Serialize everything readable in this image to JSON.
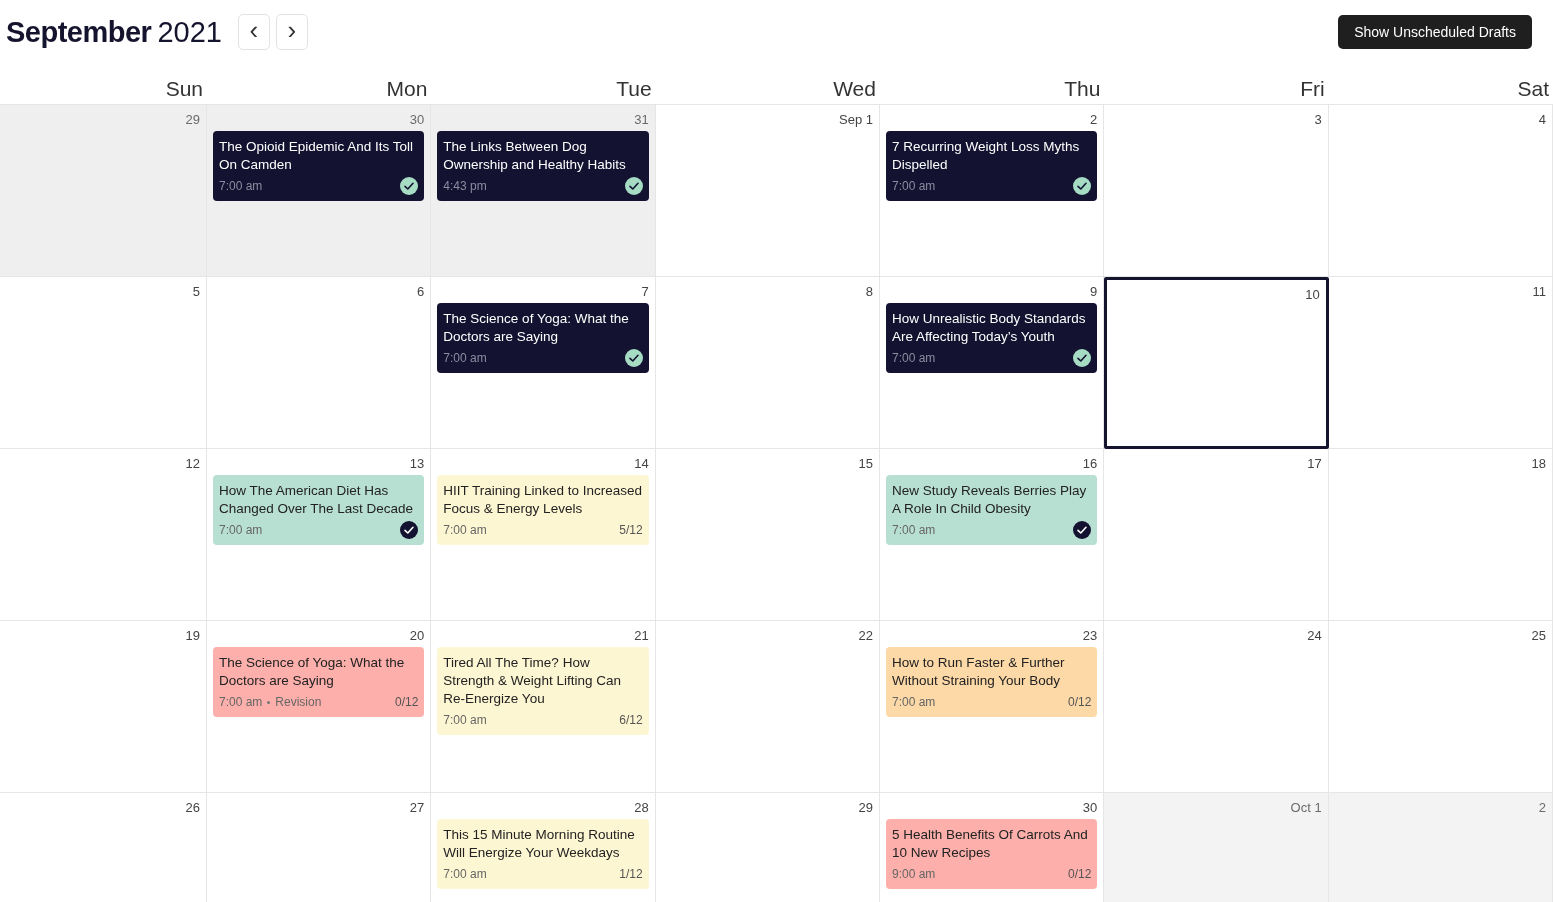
{
  "header": {
    "month": "September",
    "year": "2021",
    "prev_button": "‹",
    "next_button": "›",
    "drafts_button": "Show Unscheduled Drafts"
  },
  "weekdays": [
    "Sun",
    "Mon",
    "Tue",
    "Wed",
    "Thu",
    "Fri",
    "Sat"
  ],
  "weeks": [
    [
      {
        "label": "29",
        "outside": true,
        "today": false
      },
      {
        "label": "30",
        "outside": true,
        "today": false,
        "posts": [
          {
            "kind": "published",
            "color": "#131230",
            "title": "The Opioid Epidemic And Its Toll On Camden",
            "time": "7:00 am"
          }
        ]
      },
      {
        "label": "31",
        "outside": true,
        "today": false,
        "posts": [
          {
            "kind": "published",
            "color": "#131230",
            "title": "The Links Between Dog Ownership and Healthy Habits",
            "time": "4:43 pm"
          }
        ]
      },
      {
        "label": "Sep 1",
        "outside": false,
        "today": false
      },
      {
        "label": "2",
        "outside": false,
        "today": false,
        "posts": [
          {
            "kind": "published",
            "color": "#131230",
            "title": "7 Recurring Weight Loss Myths Dispelled",
            "time": "7:00 am"
          }
        ]
      },
      {
        "label": "3",
        "outside": false,
        "today": false
      },
      {
        "label": "4",
        "outside": false,
        "today": false
      }
    ],
    [
      {
        "label": "5",
        "outside": false,
        "today": false
      },
      {
        "label": "6",
        "outside": false,
        "today": false
      },
      {
        "label": "7",
        "outside": false,
        "today": false,
        "posts": [
          {
            "kind": "published",
            "color": "#131230",
            "title": "The Science of Yoga: What the Doctors are Saying",
            "time": "7:00 am"
          }
        ]
      },
      {
        "label": "8",
        "outside": false,
        "today": false
      },
      {
        "label": "9",
        "outside": false,
        "today": false,
        "posts": [
          {
            "kind": "published",
            "color": "#131230",
            "title": "How Unrealistic Body Standards Are Affecting Today’s Youth",
            "time": "7:00 am"
          }
        ]
      },
      {
        "label": "10",
        "outside": false,
        "today": true
      },
      {
        "label": "11",
        "outside": false,
        "today": false
      }
    ],
    [
      {
        "label": "12",
        "outside": false,
        "today": false
      },
      {
        "label": "13",
        "outside": false,
        "today": false,
        "posts": [
          {
            "kind": "approved",
            "color": "#b8e0d2",
            "title": "How The American Diet Has Changed Over The Last Decade",
            "time": "7:00 am"
          }
        ]
      },
      {
        "label": "14",
        "outside": false,
        "today": false,
        "posts": [
          {
            "kind": "draft",
            "color": "#fdf6d3",
            "title": "HIIT Training Linked to Increased Focus & Energy Levels",
            "time": "7:00 am",
            "progress": "5/12"
          }
        ]
      },
      {
        "label": "15",
        "outside": false,
        "today": false
      },
      {
        "label": "16",
        "outside": false,
        "today": false,
        "posts": [
          {
            "kind": "approved",
            "color": "#b8e0d2",
            "title": "New Study Reveals Berries Play A Role In Child Obesity",
            "time": "7:00 am"
          }
        ]
      },
      {
        "label": "17",
        "outside": false,
        "today": false
      },
      {
        "label": "18",
        "outside": false,
        "today": false
      }
    ],
    [
      {
        "label": "19",
        "outside": false,
        "today": false
      },
      {
        "label": "20",
        "outside": false,
        "today": false,
        "posts": [
          {
            "kind": "draft",
            "color": "#fdb0ab",
            "title": "The Science of Yoga: What the Doctors are Saying",
            "time": "7:00 am",
            "note": "Revision",
            "progress": "0/12"
          }
        ]
      },
      {
        "label": "21",
        "outside": false,
        "today": false,
        "posts": [
          {
            "kind": "draft",
            "color": "#fdf6d3",
            "title": "Tired All The Time? How Strength & Weight Lifting Can Re-Energize You",
            "time": "7:00 am",
            "progress": "6/12"
          }
        ]
      },
      {
        "label": "22",
        "outside": false,
        "today": false
      },
      {
        "label": "23",
        "outside": false,
        "today": false,
        "posts": [
          {
            "kind": "draft",
            "color": "#fdd9a8",
            "title": "How to Run Faster & Further Without Straining Your Body",
            "time": "7:00 am",
            "progress": "0/12"
          }
        ]
      },
      {
        "label": "24",
        "outside": false,
        "today": false
      },
      {
        "label": "25",
        "outside": false,
        "today": false
      }
    ],
    [
      {
        "label": "26",
        "outside": false,
        "today": false
      },
      {
        "label": "27",
        "outside": false,
        "today": false
      },
      {
        "label": "28",
        "outside": false,
        "today": false,
        "posts": [
          {
            "kind": "draft",
            "color": "#fdf6d3",
            "title": "This 15 Minute Morning Routine Will Energize Your Weekdays",
            "time": "7:00 am",
            "progress": "1/12"
          }
        ]
      },
      {
        "label": "29",
        "outside": false,
        "today": false
      },
      {
        "label": "30",
        "outside": false,
        "today": false,
        "posts": [
          {
            "kind": "draft",
            "color": "#fdb0ab",
            "title": "5 Health Benefits Of Carrots And 10 New Recipes",
            "time": "9:00 am",
            "progress": "0/12"
          }
        ]
      },
      {
        "label": "Oct 1",
        "outside": true,
        "today": false
      },
      {
        "label": "2",
        "outside": true,
        "today": false
      }
    ]
  ]
}
